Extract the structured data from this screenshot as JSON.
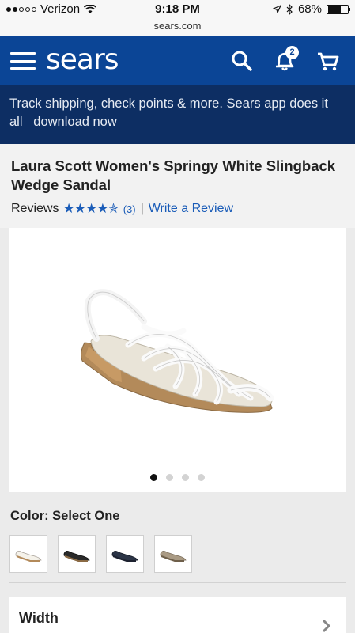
{
  "status_bar": {
    "carrier": "Verizon",
    "time": "9:18 PM",
    "battery": "68%",
    "battery_level": 0.68,
    "url": "sears.com"
  },
  "header": {
    "logo": "sears",
    "notification_count": "2",
    "brand_color": "#0b4596",
    "icons": [
      "menu-icon",
      "search-icon",
      "bell-icon",
      "cart-icon"
    ]
  },
  "promo": {
    "text": "Track shipping, check points & more. Sears app does it all",
    "link": "download now"
  },
  "product": {
    "title": "Laura Scott Women's Springy White Slingback Wedge Sandal",
    "reviews_label": "Reviews",
    "rating": 4.5,
    "stars": "★★★★✯",
    "review_count": "(3)",
    "separator": "|",
    "write_review": "Write a Review",
    "image_count": 4,
    "active_image": 0
  },
  "options": {
    "color_label": "Color: Select One",
    "swatches": [
      "white",
      "black",
      "navy",
      "taupe"
    ],
    "width_label": "Width"
  }
}
